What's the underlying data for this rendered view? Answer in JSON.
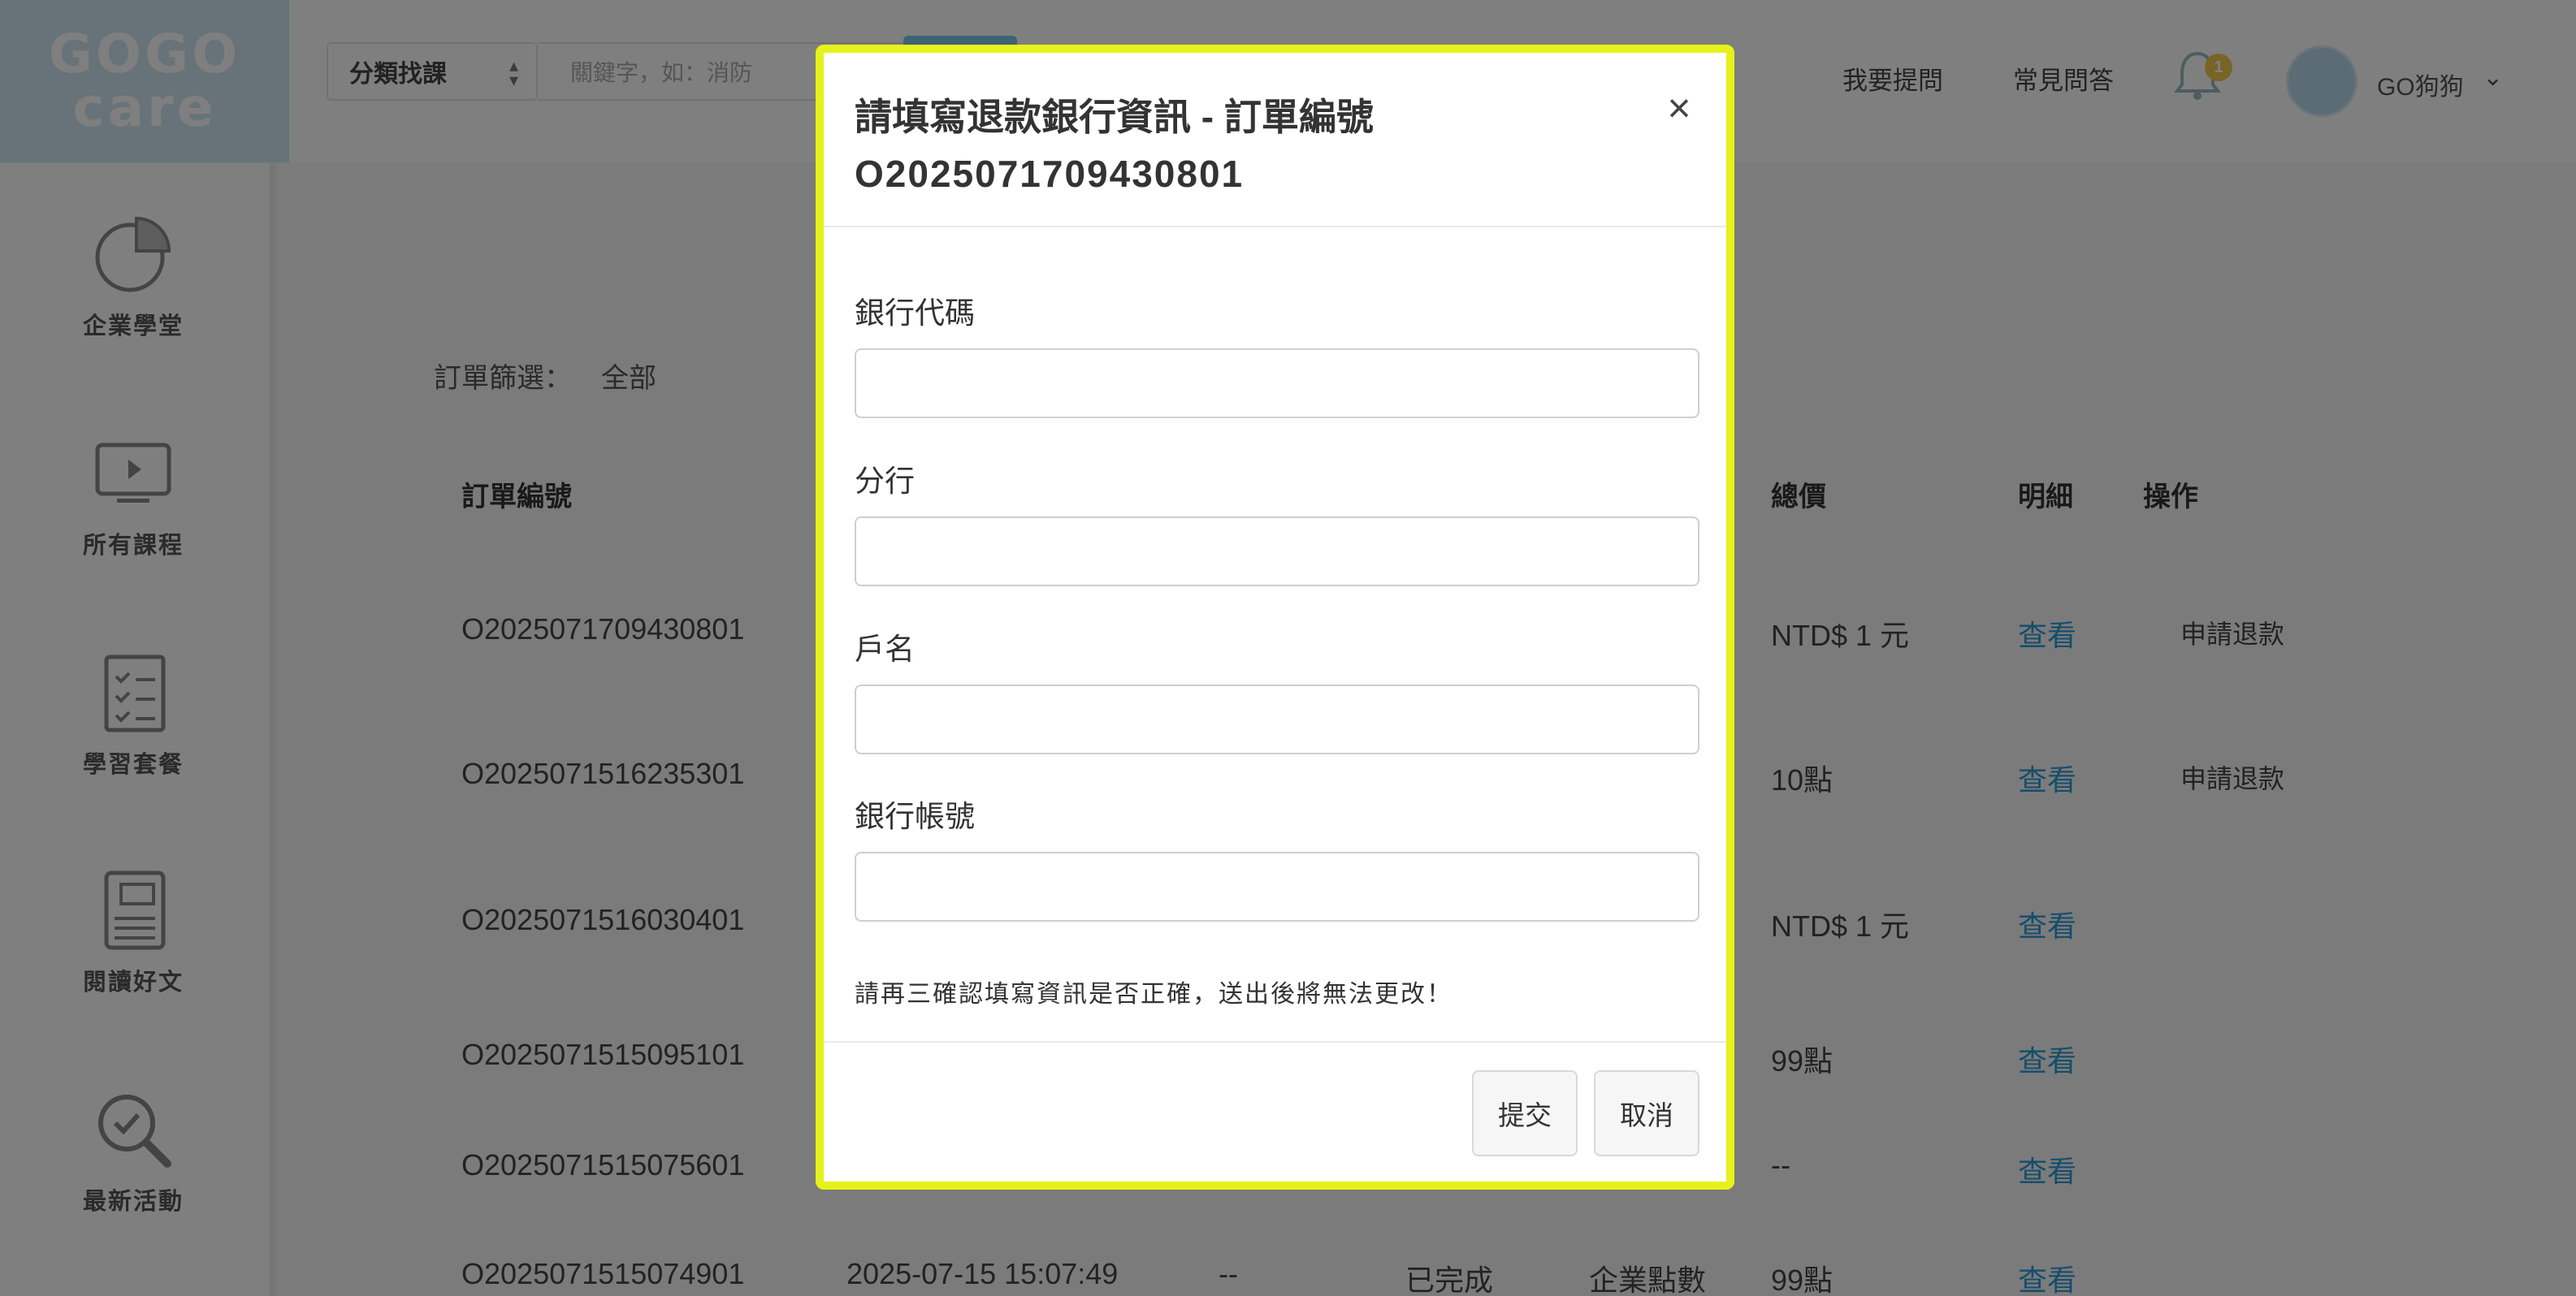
{
  "logo": {
    "line1": "GOGO",
    "line2": "care"
  },
  "sidebar": {
    "items": [
      {
        "label": "企業學堂",
        "icon": "pie-chart-icon"
      },
      {
        "label": "所有課程",
        "icon": "monitor-play-icon"
      },
      {
        "label": "學習套餐",
        "icon": "checklist-icon"
      },
      {
        "label": "閱讀好文",
        "icon": "book-icon"
      },
      {
        "label": "最新活動",
        "icon": "magnifier-check-icon"
      }
    ]
  },
  "topbar": {
    "category_select": "分類找課",
    "search_placeholder": "關鍵字，如：消防",
    "ask": "我要提問",
    "faq": "常見問答",
    "notification_count": "1",
    "username": "GO狗狗"
  },
  "filter": {
    "label": "訂單篩選：",
    "value": "全部"
  },
  "table": {
    "headers": {
      "order_no": "訂單編號",
      "total": "總價",
      "detail": "明細",
      "action": "操作"
    },
    "rows": [
      {
        "order_no": "O2025071709430801",
        "date": "",
        "points": "",
        "status": "",
        "method": "",
        "total": "NTD$ 1 元",
        "detail": "查看",
        "action": "申請退款"
      },
      {
        "order_no": "O2025071516235301",
        "date": "",
        "points": "",
        "status": "",
        "method": "",
        "total": "10點",
        "detail": "查看",
        "action": "申請退款"
      },
      {
        "order_no": "O2025071516030401",
        "date": "",
        "points": "",
        "status": "",
        "method": "",
        "total": "NTD$ 1 元",
        "detail": "查看",
        "action": ""
      },
      {
        "order_no": "O2025071515095101",
        "date": "",
        "points": "",
        "status": "",
        "method": "",
        "total": "99點",
        "detail": "查看",
        "action": ""
      },
      {
        "order_no": "O2025071515075601",
        "date": "",
        "points": "",
        "status": "",
        "method": "",
        "total": "--",
        "detail": "查看",
        "action": ""
      },
      {
        "order_no": "O2025071515074901",
        "date": "2025-07-15 15:07:49",
        "points": "--",
        "status": "已完成",
        "method": "企業點數",
        "total": "99點",
        "detail": "查看",
        "action": ""
      }
    ]
  },
  "modal": {
    "title": "請填寫退款銀行資訊 - 訂單編號",
    "order_no": "O2025071709430801",
    "close": "×",
    "fields": {
      "bank_code": {
        "label": "銀行代碼",
        "value": ""
      },
      "branch": {
        "label": "分行",
        "value": ""
      },
      "account_name": {
        "label": "戶名",
        "value": ""
      },
      "account_number": {
        "label": "銀行帳號",
        "value": ""
      }
    },
    "warning": "請再三確認填寫資訊是否正確，送出後將無法更改！",
    "submit": "提交",
    "cancel": "取消"
  },
  "colors": {
    "accent": "#2a9ad6",
    "highlight_border": "#e6f21a",
    "overlay": "rgba(0,0,0,0.5)"
  }
}
